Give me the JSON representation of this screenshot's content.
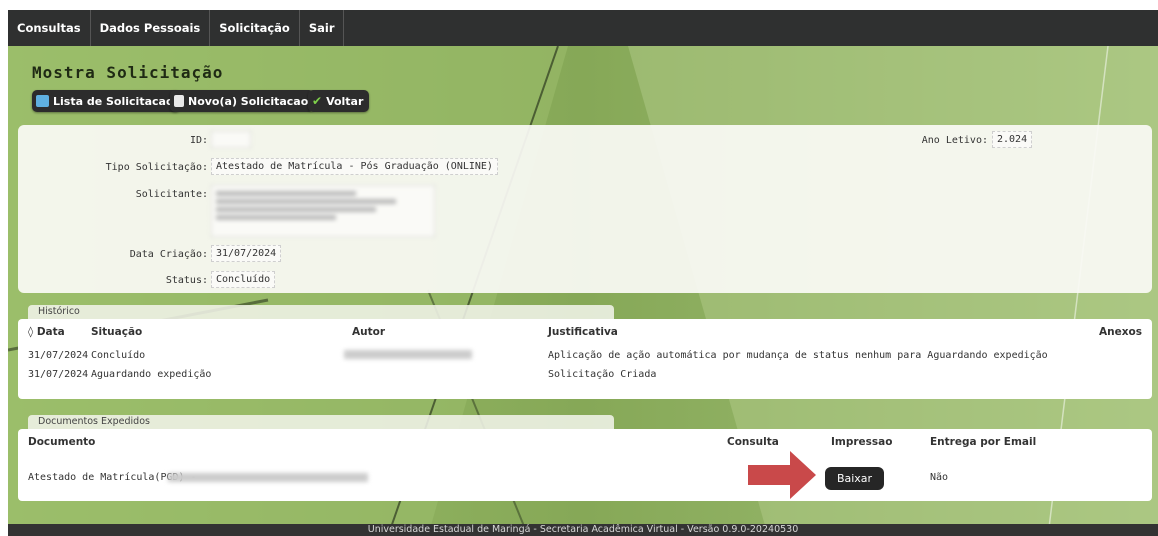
{
  "menu": {
    "items": [
      {
        "label": "Consultas"
      },
      {
        "label": "Dados Pessoais"
      },
      {
        "label": "Solicitação"
      },
      {
        "label": "Sair"
      }
    ]
  },
  "page": {
    "title": "Mostra Solicitação"
  },
  "toolbar": {
    "lista_label": "Lista de Solicitacao",
    "novo_label": "Novo(a) Solicitacao",
    "voltar_label": "Voltar"
  },
  "details": {
    "id_label": "ID:",
    "id_value": "",
    "ano_label": "Ano Letivo:",
    "ano_value": "2.024",
    "tipo_label": "Tipo Solicitação:",
    "tipo_value": "Atestado de Matrícula - Pós Graduação (ONLINE)",
    "solicitante_label": "Solicitante:",
    "data_label": "Data Criação:",
    "data_value": "31/07/2024",
    "status_label": "Status:",
    "status_value": "Concluído"
  },
  "historico": {
    "tab": "Histórico",
    "columns": {
      "data": "◊ Data",
      "situacao": "Situação",
      "autor": "Autor",
      "justificativa": "Justificativa",
      "anexos": "Anexos"
    },
    "rows": [
      {
        "data": "31/07/2024",
        "situacao": "Concluído",
        "autor": "",
        "justificativa": "Aplicação de ação automática por mudança de status nenhum para Aguardando expedição"
      },
      {
        "data": "31/07/2024",
        "situacao": "Aguardando expedição",
        "autor": "",
        "justificativa": "Solicitação Criada"
      }
    ]
  },
  "documentos": {
    "tab": "Documentos Expedidos",
    "columns": {
      "documento": "Documento",
      "consulta": "Consulta",
      "impressao": "Impressao",
      "entrega": "Entrega por Email"
    },
    "rows": [
      {
        "documento": "Atestado de Matrícula(PGD) -",
        "baixar": "Baixar",
        "entrega": "Não"
      }
    ]
  },
  "footer": {
    "text": "Universidade Estadual de Maringá - Secretaria Acadêmica Virtual - Versão 0.9.0-20240530"
  },
  "colors": {
    "accent_green": "#8fb25e",
    "menu_bg": "#2f3030",
    "arrow": "#c9494a"
  }
}
